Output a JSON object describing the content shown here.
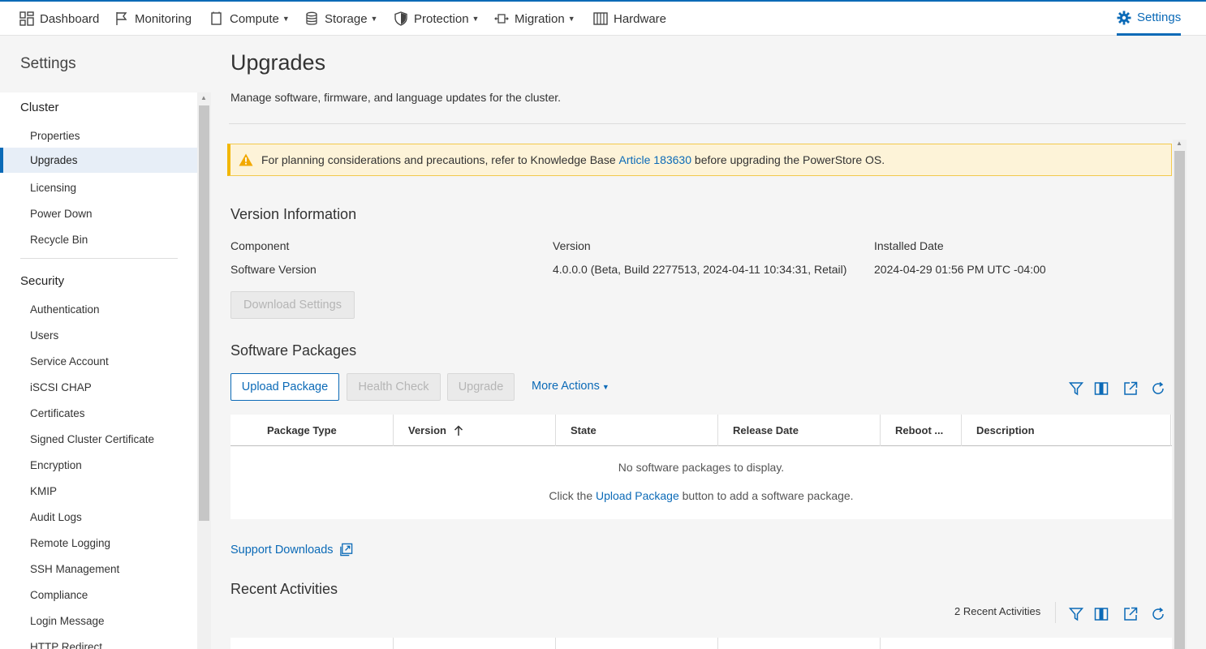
{
  "nav": {
    "items": [
      {
        "label": "Dashboard",
        "icon": "dashboard-icon"
      },
      {
        "label": "Monitoring",
        "icon": "flag-icon"
      },
      {
        "label": "Compute",
        "icon": "compute-icon",
        "dropdown": true
      },
      {
        "label": "Storage",
        "icon": "database-icon",
        "dropdown": true
      },
      {
        "label": "Protection",
        "icon": "shield-icon",
        "dropdown": true
      },
      {
        "label": "Migration",
        "icon": "migration-icon",
        "dropdown": true
      },
      {
        "label": "Hardware",
        "icon": "hardware-icon"
      }
    ],
    "settings_label": "Settings",
    "accent": "#0b6ab7"
  },
  "sidebar": {
    "title": "Settings",
    "sections": [
      {
        "title": "Cluster",
        "items": [
          "Properties",
          "Upgrades",
          "Licensing",
          "Power Down",
          "Recycle Bin"
        ]
      },
      {
        "title": "Security",
        "items": [
          "Authentication",
          "Users",
          "Service Account",
          "iSCSI CHAP",
          "Certificates",
          "Signed Cluster Certificate",
          "Encryption",
          "KMIP",
          "Audit Logs",
          "Remote Logging",
          "SSH Management",
          "Compliance",
          "Login Message",
          "HTTP Redirect"
        ]
      }
    ],
    "active": "Upgrades"
  },
  "page": {
    "title": "Upgrades",
    "description": "Manage software, firmware, and language updates for the cluster."
  },
  "alert": {
    "text_before": "For planning considerations and precautions, refer to Knowledge Base ",
    "link": "Article 183630",
    "text_after": " before upgrading the PowerStore OS.",
    "color": "#f2b705"
  },
  "version_info": {
    "heading": "Version Information",
    "col_component": "Component",
    "col_version": "Version",
    "col_installed": "Installed Date",
    "component": "Software Version",
    "version": "4.0.0.0 (Beta, Build 2277513, 2024-04-11 10:34:31, Retail)",
    "installed": "2024-04-29 01:56 PM UTC -04:00",
    "download_button": "Download Settings"
  },
  "packages": {
    "heading": "Software Packages",
    "upload_button": "Upload Package",
    "health_button": "Health Check",
    "upgrade_button": "Upgrade",
    "more_actions": "More Actions",
    "columns": [
      "Package Type",
      "Version",
      "State",
      "Release Date",
      "Reboot ...",
      "Description"
    ],
    "sorted_column": "Version",
    "empty_title": "No software packages to display.",
    "empty_before": "Click the ",
    "empty_link": "Upload Package",
    "empty_after": " button to add a software package."
  },
  "support_downloads": "Support Downloads",
  "recent": {
    "heading": "Recent Activities",
    "count_label": "2 Recent Activities"
  }
}
